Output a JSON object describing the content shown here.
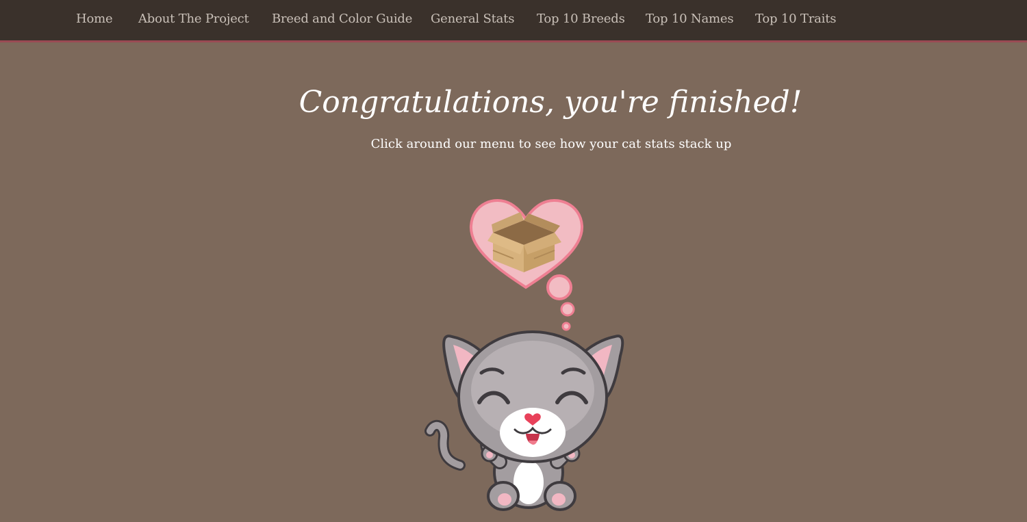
{
  "nav": {
    "items": [
      "Home",
      "About The Project",
      "Breed and Color Guide",
      "General Stats",
      "Top 10 Breeds",
      "Top 10 Names",
      "Top 10 Traits"
    ]
  },
  "main": {
    "headline": "Congratulations, you're finished!",
    "subheading": "Click around our menu to see how your cat stats stack up"
  },
  "colors": {
    "background": "#7d695b",
    "navbar": "#3a312b",
    "navbar_border": "#9a4a54",
    "heart_fill": "#f2bcc3",
    "heart_stroke": "#ee7f92"
  },
  "illustration": {
    "description_icons": [
      "cat-icon",
      "heart-thought-bubble-icon",
      "cardboard-box-icon"
    ]
  }
}
